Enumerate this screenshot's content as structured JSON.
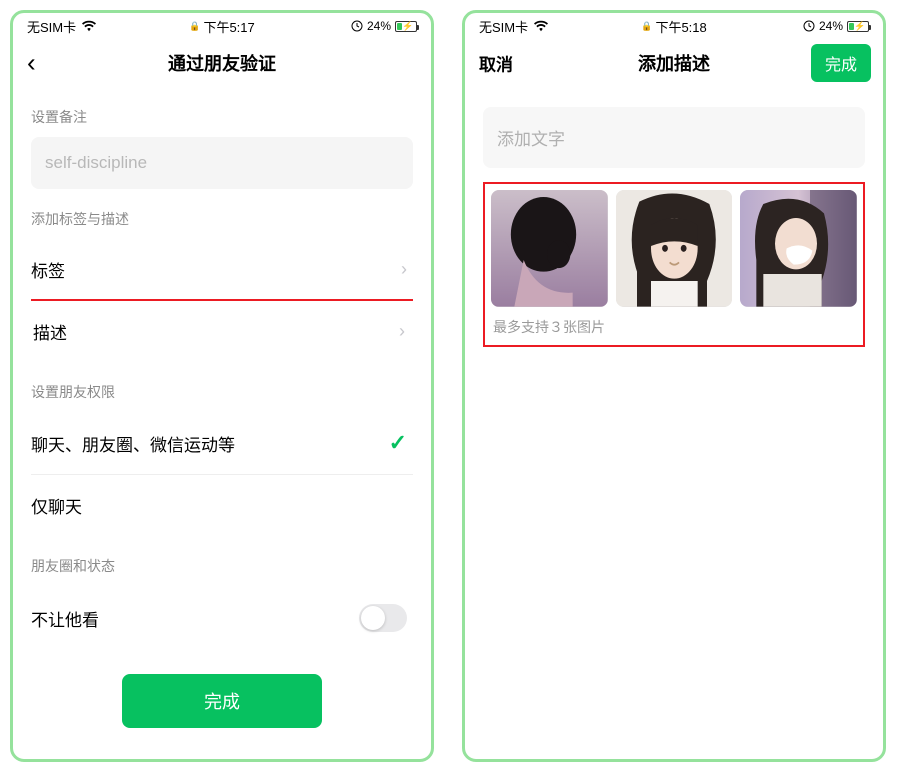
{
  "left": {
    "status": {
      "sim": "无SIM卡",
      "time": "下午5:17",
      "battery_pct": "24%"
    },
    "nav": {
      "title": "通过朋友验证"
    },
    "remark_label": "设置备注",
    "remark_value": "self-discipline",
    "tags_label": "添加标签与描述",
    "cell_tags": "标签",
    "cell_desc": "描述",
    "perm_label": "设置朋友权限",
    "perm_opt1": "聊天、朋友圈、微信运动等",
    "perm_opt2": "仅聊天",
    "moments_label": "朋友圈和状态",
    "moments_block": "不让他看",
    "done": "完成"
  },
  "right": {
    "status": {
      "sim": "无SIM卡",
      "time": "下午5:18",
      "battery_pct": "24%"
    },
    "nav": {
      "cancel": "取消",
      "title": "添加描述",
      "done": "完成"
    },
    "placeholder": "添加文字",
    "photos": [
      "photo-1",
      "photo-2",
      "photo-3"
    ],
    "hint": "最多支持３张图片"
  }
}
